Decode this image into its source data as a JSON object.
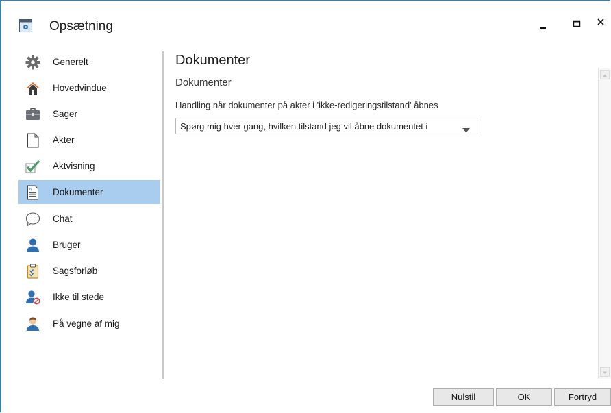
{
  "window": {
    "title": "Opsætning",
    "icon": "settings-app-icon",
    "controls": [
      "minimize-icon",
      "maximize-icon",
      "close-icon"
    ]
  },
  "sidebar": {
    "items": [
      {
        "label": "Generelt",
        "icon": "gear-icon"
      },
      {
        "label": "Hovedvindue",
        "icon": "home-icon"
      },
      {
        "label": "Sager",
        "icon": "briefcase-icon"
      },
      {
        "label": "Akter",
        "icon": "document-icon"
      },
      {
        "label": "Aktvisning",
        "icon": "checkmark-icon"
      },
      {
        "label": "Dokumenter",
        "icon": "text-document-icon",
        "selected": true
      },
      {
        "label": "Chat",
        "icon": "chat-bubble-icon"
      },
      {
        "label": "Bruger",
        "icon": "user-icon"
      },
      {
        "label": "Sagsforløb",
        "icon": "clipboard-check-icon"
      },
      {
        "label": "Ikke til stede",
        "icon": "user-absent-icon"
      },
      {
        "label": "På vegne af mig",
        "icon": "delegate-user-icon"
      }
    ]
  },
  "main": {
    "page_title": "Dokumenter",
    "section_title": "Dokumenter",
    "field_label": "Handling når dokumenter på akter i 'ikke-redigeringstilstand' åbnes",
    "dropdown_value": "Spørg mig hver gang, hvilken tilstand jeg vil åbne dokumentet i"
  },
  "footer": {
    "reset_label": "Nulstil",
    "ok_label": "OK",
    "cancel_label": "Fortryd"
  },
  "colors": {
    "selection": "#a9cdef",
    "window_border": "#2b7fd4",
    "icon_blue": "#2d6fb3",
    "icon_green": "#4c9a6a"
  }
}
